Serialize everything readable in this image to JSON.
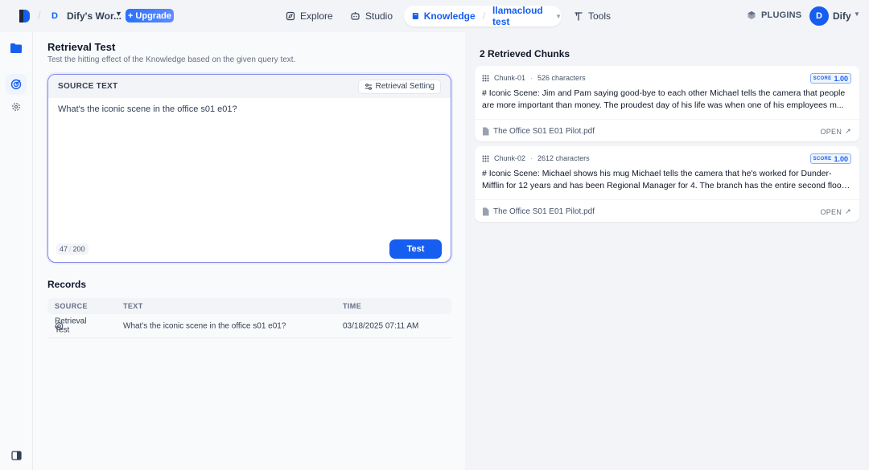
{
  "topbar": {
    "workspace_initial": "D",
    "workspace_name": "Dify's Wor...",
    "upgrade_label": "Upgrade",
    "nav": {
      "explore": "Explore",
      "studio": "Studio",
      "knowledge": "Knowledge",
      "dataset": "llamacloud test",
      "tools": "Tools"
    },
    "plugins_label": "PLUGINS",
    "user_initial": "D",
    "user_name": "Dify"
  },
  "main": {
    "title": "Retrieval Test",
    "subtitle": "Test the hitting effect of the Knowledge based on the given query text.",
    "source": {
      "label": "SOURCE TEXT",
      "setting_label": "Retrieval Setting",
      "query": "What's the iconic scene in the office s01 e01?",
      "count": "47",
      "max": "200",
      "test_label": "Test"
    },
    "records": {
      "title": "Records",
      "columns": [
        "SOURCE",
        "TEXT",
        "TIME"
      ],
      "rows": [
        {
          "source": "Retrieval Test",
          "text": "What's the iconic scene in the office s01 e01?",
          "time": "03/18/2025 07:11 AM"
        }
      ]
    }
  },
  "results": {
    "title": "2 Retrieved Chunks",
    "score_label": "SCORE",
    "open_label": "OPEN",
    "chunks": [
      {
        "id": "Chunk-01",
        "chars": "526 characters",
        "score": "1.00",
        "text": "# Iconic Scene: Jim and Pam saying good-bye to each other Michael tells the camera that people are more important than money. The proudest day of his life was when one of his employees m...",
        "file": "The Office S01 E01 Pilot.pdf"
      },
      {
        "id": "Chunk-02",
        "chars": "2612 characters",
        "score": "1.00",
        "text": "# Iconic Scene: Michael shows his mug Michael tells the camera that he's worked for Dunder-Mifflin for 12 years and has been Regional Manager for 4. The branch has the entire second floor o...",
        "file": "The Office S01 E01 Pilot.pdf"
      }
    ]
  },
  "colors": {
    "accent": "#155eef",
    "focus_border": "#7f86e8",
    "background": "#f2f4f7"
  }
}
